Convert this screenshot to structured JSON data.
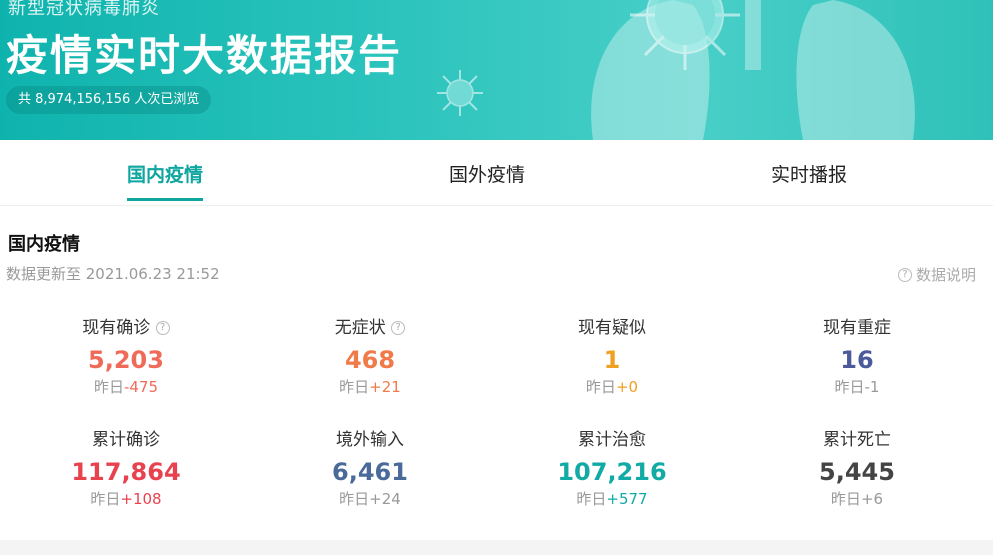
{
  "banner": {
    "subtitle": "新型冠状病毒肺炎",
    "title": "疫情实时大数据报告",
    "views": "共 8,974,156,156 人次已浏览"
  },
  "tabs": [
    {
      "label": "国内疫情",
      "active": true
    },
    {
      "label": "国外疫情",
      "active": false
    },
    {
      "label": "实时播报",
      "active": false
    }
  ],
  "section": {
    "title": "国内疫情",
    "update_time": "数据更新至 2021.06.23 21:52",
    "data_note": "数据说明"
  },
  "stats": [
    {
      "label": "现有确诊",
      "has_help": true,
      "value": "5,203",
      "delta_prefix": "昨日",
      "delta": "-475",
      "value_color": "#f06a5a",
      "delta_color": "#f06a5a"
    },
    {
      "label": "无症状",
      "has_help": true,
      "value": "468",
      "delta_prefix": "昨日",
      "delta": "+21",
      "value_color": "#f07a4a",
      "delta_color": "#f07a4a"
    },
    {
      "label": "现有疑似",
      "has_help": false,
      "value": "1",
      "delta_prefix": "昨日",
      "delta": "+0",
      "value_color": "#f0a020",
      "delta_color": "#f0a020"
    },
    {
      "label": "现有重症",
      "has_help": false,
      "value": "16",
      "delta_prefix": "昨日",
      "delta": "-1",
      "value_color": "#4a5a9a",
      "delta_color": "#999999"
    },
    {
      "label": "累计确诊",
      "has_help": false,
      "value": "117,864",
      "delta_prefix": "昨日",
      "delta": "+108",
      "value_color": "#e8424f",
      "delta_color": "#e8424f"
    },
    {
      "label": "境外输入",
      "has_help": false,
      "value": "6,461",
      "delta_prefix": "昨日",
      "delta": "+24",
      "value_color": "#4a6a9a",
      "delta_color": "#999999"
    },
    {
      "label": "累计治愈",
      "has_help": false,
      "value": "107,216",
      "delta_prefix": "昨日",
      "delta": "+577",
      "value_color": "#12aaa5",
      "delta_color": "#12aaa5"
    },
    {
      "label": "累计死亡",
      "has_help": false,
      "value": "5,445",
      "delta_prefix": "昨日",
      "delta": "+6",
      "value_color": "#444444",
      "delta_color": "#999999"
    }
  ],
  "icons": {
    "help": "question-circle-icon",
    "virus": "virus-icon",
    "lungs": "lungs-icon"
  },
  "colors": {
    "accent": "#0fa6a0",
    "banner": "#2cc4bd"
  }
}
